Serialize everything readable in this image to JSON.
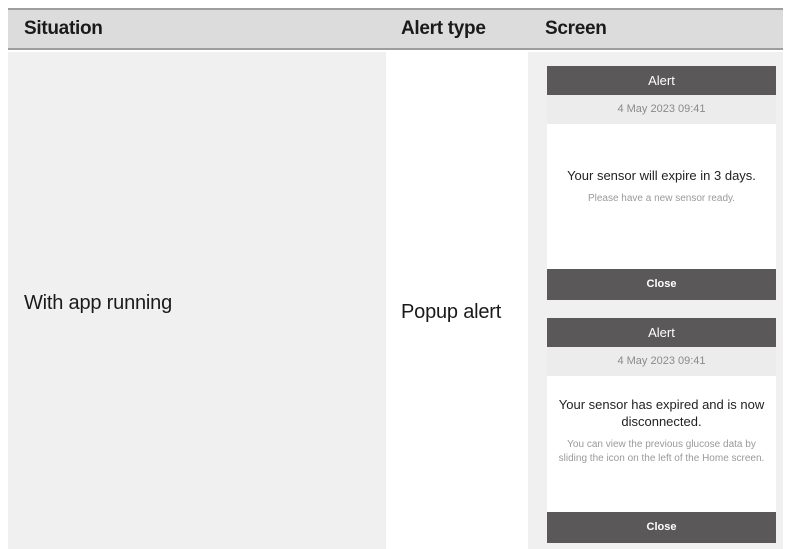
{
  "table": {
    "headers": {
      "situation": "Situation",
      "alert_type": "Alert type",
      "screen": "Screen"
    },
    "row": {
      "situation": "With app running",
      "alert_type": "Popup alert"
    }
  },
  "popups": [
    {
      "title": "Alert",
      "datetime": "4 May 2023  09:41",
      "message": "Your sensor will expire in 3 days.",
      "detail": "Please have a new sensor ready.",
      "close_label": "Close"
    },
    {
      "title": "Alert",
      "datetime": "4 May 2023  09:41",
      "message": "Your sensor has expired and is now disconnected.",
      "detail": "You can view the previous glucose data by sliding the icon on the left of the Home screen.",
      "close_label": "Close"
    }
  ],
  "colors": {
    "header_bg": "#dcdcdc",
    "header_rule": "#9d9d9d",
    "column_shade": "#f0f0f0",
    "popup_bar": "#5a5858",
    "popup_date_bg": "#ececec"
  }
}
